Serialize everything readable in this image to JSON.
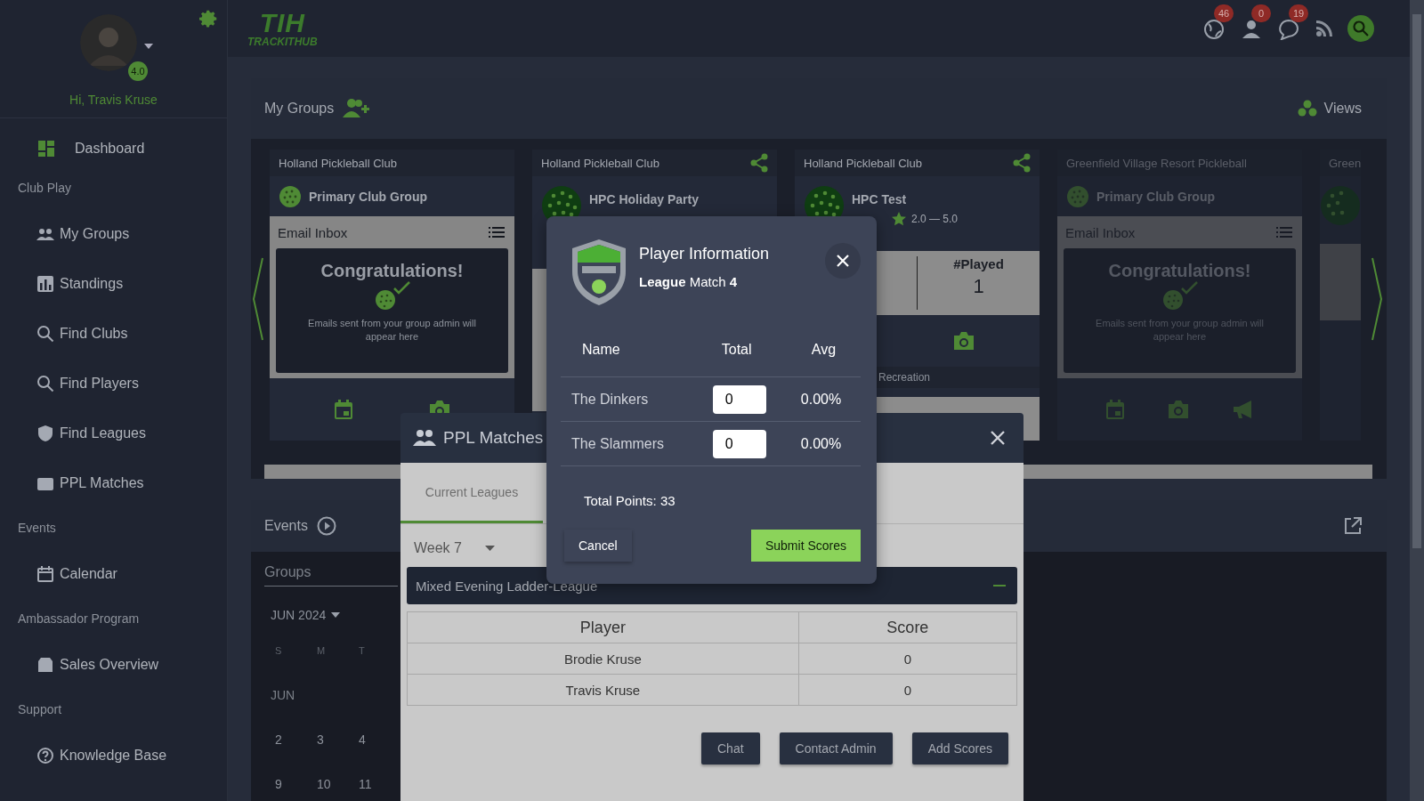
{
  "sidebar": {
    "rating": "4.0",
    "greeting": "Hi, Travis Kruse",
    "items": [
      {
        "kind": "link",
        "label": "Dashboard"
      },
      {
        "kind": "section",
        "label": "Club Play"
      },
      {
        "kind": "link",
        "label": "My Groups"
      },
      {
        "kind": "link",
        "label": "Standings"
      },
      {
        "kind": "link",
        "label": "Find Clubs"
      },
      {
        "kind": "link",
        "label": "Find Players"
      },
      {
        "kind": "link",
        "label": "Find Leagues"
      },
      {
        "kind": "link",
        "label": "PPL Matches"
      },
      {
        "kind": "section",
        "label": "Events"
      },
      {
        "kind": "link",
        "label": "Calendar"
      },
      {
        "kind": "section",
        "label": "Ambassador Program"
      },
      {
        "kind": "link",
        "label": "Sales Overview"
      },
      {
        "kind": "section",
        "label": "Support"
      },
      {
        "kind": "link",
        "label": "Knowledge Base"
      }
    ]
  },
  "topbar": {
    "logo_mark": "TIH",
    "logo_name": "TRACKITHUB",
    "notifications": [
      {
        "count": "46"
      },
      {
        "count": "0"
      },
      {
        "count": "19"
      }
    ]
  },
  "groups_panel": {
    "title": "My Groups",
    "views": "Views",
    "cards": [
      {
        "kind": "inbox",
        "club": "Holland Pickleball Club",
        "group": "Primary Club Group",
        "shared": false,
        "dimmed": false,
        "inbox_title": "Email Inbox",
        "heading": "Congratulations!",
        "message": "Emails sent from your group admin will appear here"
      },
      {
        "kind": "covered",
        "club": "Holland Pickleball Club",
        "group": "HPC Holiday Party",
        "shared": true,
        "dimmed": false
      },
      {
        "kind": "stats",
        "club": "Holland Pickleball Club",
        "group": "HPC Test",
        "shared": true,
        "dimmed": false,
        "range": "2.0 — 5.0",
        "stat_label": "#Played",
        "stat_value": "1",
        "tag": "Recreation"
      },
      {
        "kind": "inbox",
        "club": "Greenfield Village Resort Pickleball",
        "group": "Primary Club Group",
        "shared": false,
        "dimmed": true,
        "inbox_title": "Email Inbox",
        "heading": "Congratulations!",
        "message": "Emails sent from your group admin will appear here"
      },
      {
        "kind": "partial",
        "club": "Green",
        "shared": false,
        "dimmed": true
      }
    ]
  },
  "events_panel": {
    "title": "Events",
    "tab": "Groups",
    "month": "JUN 2024",
    "weekdays": [
      "S",
      "M",
      "T"
    ],
    "month_label": "JUN",
    "weeks": [
      [
        "2",
        "3",
        "4"
      ],
      [
        "9",
        "10",
        "11"
      ]
    ]
  },
  "ppl_dialog": {
    "title": "PPL Matches",
    "tabs": [
      {
        "label": "Current Leagues",
        "selected": true
      }
    ],
    "week": "Week 7",
    "league": "Mixed Evening Ladder-League",
    "expanded": true,
    "columns": [
      "Player",
      "Score"
    ],
    "rows": [
      [
        "Brodie Kruse",
        "0"
      ],
      [
        "Travis Kruse",
        "0"
      ]
    ],
    "buttons": [
      "Chat",
      "Contact Admin",
      "Add Scores"
    ]
  },
  "player_dialog": {
    "title": "Player Information",
    "subtitle": "**League** Match **4**",
    "columns": [
      "Name",
      "Total",
      "Avg"
    ],
    "rows": [
      {
        "name": "The Dinkers",
        "total": "0",
        "avg": "0.00%"
      },
      {
        "name": "The Slammers",
        "total": "0",
        "avg": "0.00%"
      }
    ],
    "total_points": "Total Points: 33",
    "cancel": "Cancel",
    "submit": "Submit Scores"
  }
}
